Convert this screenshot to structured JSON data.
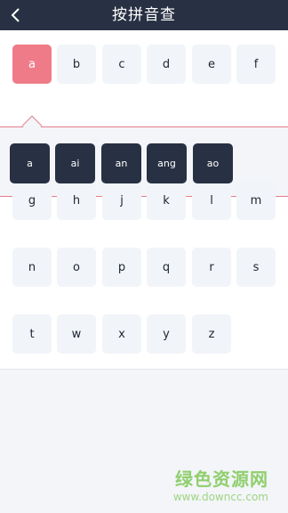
{
  "header": {
    "title": "按拼音查",
    "back_icon": "chevron-left-icon"
  },
  "letters": {
    "row1": [
      "a",
      "b",
      "c",
      "d",
      "e",
      "f"
    ],
    "row2": [
      "g",
      "h",
      "j",
      "k",
      "l",
      "m"
    ],
    "row3": [
      "n",
      "o",
      "p",
      "q",
      "r",
      "s"
    ],
    "row4": [
      "t",
      "w",
      "x",
      "y",
      "z"
    ],
    "selected": "a"
  },
  "finals": [
    "a",
    "ai",
    "an",
    "ang",
    "ao"
  ],
  "watermark": {
    "text": "绿色资源网",
    "url": "www.downcc.com"
  },
  "colors": {
    "header_bg": "#283143",
    "active_key": "#f07b88",
    "final_key_bg": "#283143",
    "accent_line": "#e57f8a"
  }
}
